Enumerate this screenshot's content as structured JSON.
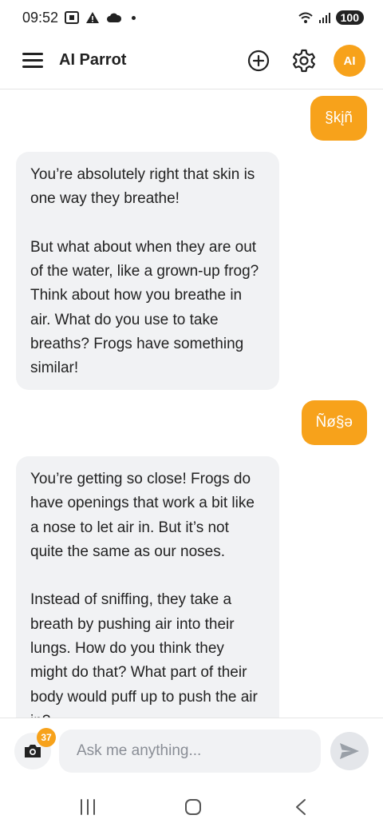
{
  "status": {
    "time": "09:52",
    "battery": "100"
  },
  "header": {
    "title": "AI Parrot",
    "avatar_initials": "AI",
    "accent_color": "#f7a21b"
  },
  "messages": [
    {
      "role": "user",
      "text": "§kįñ"
    },
    {
      "role": "assistant",
      "text": "You’re absolutely right that skin is one way they breathe!\n\nBut what about when they are out of the water, like a grown-up frog? Think about how you breathe in air. What do you use to take breaths? Frogs have something similar!"
    },
    {
      "role": "user",
      "text": "Ñø§ə"
    },
    {
      "role": "assistant",
      "text": "You’re getting so close! Frogs do have openings that work a bit like a nose to let air in. But it’s not quite the same as our noses.\n\nInstead of sniffing, they take a breath by pushing air into their lungs. How do you think they might do that? What part of their body would puff up to push the air in?"
    }
  ],
  "composer": {
    "placeholder": "Ask me anything...",
    "camera_badge": "37"
  },
  "icons": {
    "menu": "menu-icon",
    "new_chat": "plus-circle-icon",
    "settings": "gear-icon",
    "camera": "camera-icon",
    "send": "send-icon"
  }
}
